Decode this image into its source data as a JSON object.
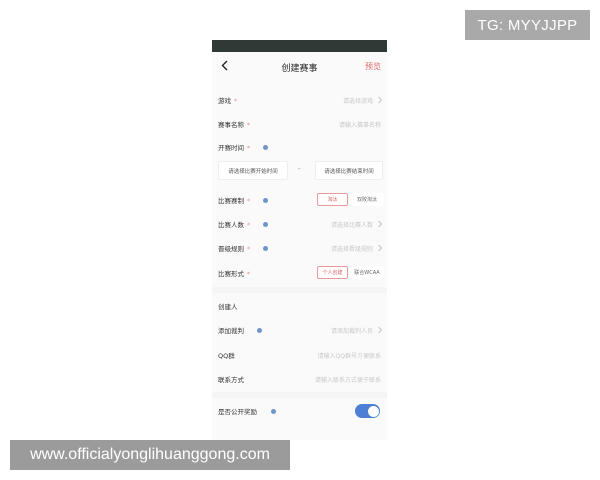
{
  "watermarks": {
    "tg": "TG: MYYJJPP",
    "url": "www.officialyonglihuanggong.com"
  },
  "nav": {
    "back_icon": "chevron-left-icon",
    "title": "创建赛事",
    "preview_label": "预览",
    "preview_color": "#e06a6a"
  },
  "form": {
    "game": {
      "label": "游戏",
      "required_mark": "*",
      "placeholder": "请选择游戏"
    },
    "name": {
      "label": "赛事名称",
      "required_mark": "*",
      "placeholder": "请输入赛事名称"
    },
    "time": {
      "label": "开赛时间",
      "required_mark": "*",
      "start_placeholder": "请选择比赛开始时间",
      "separator": "-",
      "end_placeholder": "请选择比赛结束时间"
    },
    "format": {
      "label": "比赛赛制",
      "required_mark": "*",
      "options": [
        "淘汰",
        "双败淘汰"
      ],
      "selected": "淘汰"
    },
    "players": {
      "label": "比赛人数",
      "required_mark": "*",
      "placeholder": "请选择比赛人数"
    },
    "advance": {
      "label": "晋级规则",
      "required_mark": "*",
      "placeholder": "请选择晋级规则"
    },
    "mode": {
      "label": "比赛形式",
      "required_mark": "*",
      "options": [
        "个人创建",
        "联合WCAA"
      ],
      "selected": "个人创建"
    },
    "creator": {
      "label": "创建人"
    },
    "referee": {
      "label": "添加裁判",
      "placeholder": "请添加裁判人员"
    },
    "qq": {
      "label": "QQ群",
      "placeholder": "请输入QQ群号方便联系"
    },
    "contact": {
      "label": "联系方式",
      "placeholder": "请输入联系方式便于联系"
    },
    "public_reward": {
      "label": "是否公开奖励",
      "enabled": true
    }
  },
  "colors": {
    "accent_red": "#d46767",
    "toggle_blue": "#4d7fd4",
    "info_blue": "#6f95c8",
    "status_bar": "#2f3a36"
  }
}
